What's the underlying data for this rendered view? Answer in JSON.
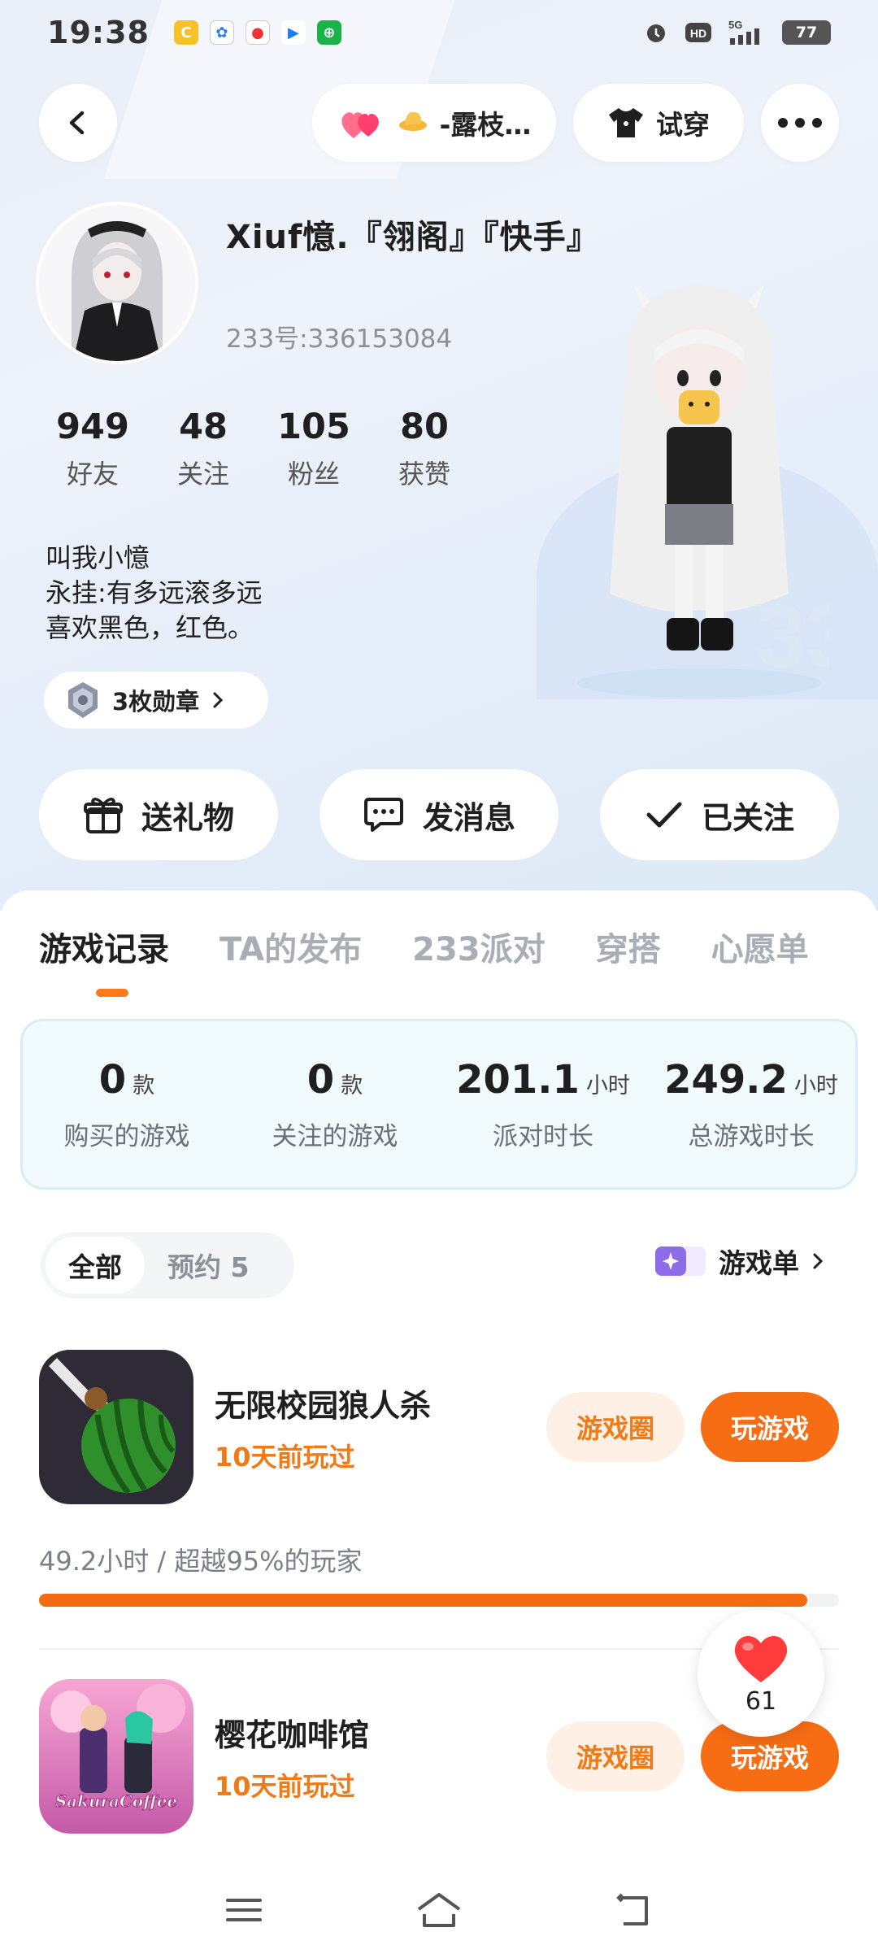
{
  "status_bar": {
    "time": "19:38",
    "network": "5G",
    "battery": "77"
  },
  "top_nav": {
    "nickname_pill": "-露枝…",
    "try_on_label": "试穿"
  },
  "profile": {
    "nickname": "Xiuf憶.『翎阁』『快手』",
    "uid": "233号:336153084",
    "stats": [
      {
        "value": "949",
        "label": "好友"
      },
      {
        "value": "48",
        "label": "关注"
      },
      {
        "value": "105",
        "label": "粉丝"
      },
      {
        "value": "80",
        "label": "获赞"
      }
    ],
    "bio": [
      "叫我小憶",
      "永挂:有多远滚多远",
      "喜欢黑色，红色。"
    ],
    "badges_label": "3枚勋章"
  },
  "actions": {
    "gift": "送礼物",
    "message": "发消息",
    "followed": "已关注"
  },
  "tabs": [
    "游戏记录",
    "TA的发布",
    "233派对",
    "穿搭",
    "心愿单"
  ],
  "summary": [
    {
      "value": "0",
      "unit": "款",
      "label": "购买的游戏"
    },
    {
      "value": "0",
      "unit": "款",
      "label": "关注的游戏"
    },
    {
      "value": "201.1",
      "unit": "小时",
      "label": "派对时长"
    },
    {
      "value": "249.2",
      "unit": "小时",
      "label": "总游戏时长"
    }
  ],
  "filter": {
    "all": "全部",
    "reserved": "预约 5"
  },
  "gamelist_link": "游戏单",
  "games": [
    {
      "name": "无限校园狼人杀",
      "last_played": "10天前玩过",
      "circle_label": "游戏圈",
      "play_label": "玩游戏",
      "playtime_text": "49.2小时 / 超越95%的玩家",
      "progress_percent": 96
    },
    {
      "name": "樱花咖啡馆",
      "last_played": "10天前玩过",
      "circle_label": "游戏圈",
      "play_label": "玩游戏",
      "icon_text": "SakuraCoffee"
    }
  ],
  "like_count": "61",
  "colors": {
    "accent_orange": "#f66d14",
    "heart_red": "#ff3b3b"
  }
}
